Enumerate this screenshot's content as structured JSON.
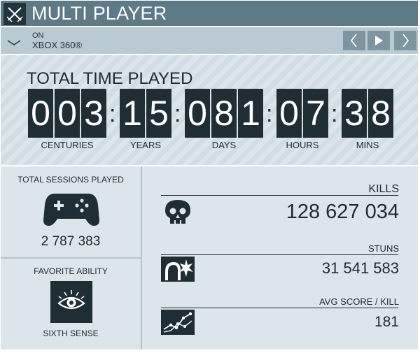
{
  "header": {
    "title": "MULTI PLAYER",
    "logo_icon": "crossed-swords-icon"
  },
  "platform": {
    "prefix": "ON",
    "name": "XBOX 360®",
    "nav": [
      "prev-chevron-icon",
      "play-icon",
      "next-chevron-icon"
    ]
  },
  "time_played": {
    "title": "TOTAL TIME PLAYED",
    "units": [
      {
        "label": "CENTURIES",
        "digits": [
          "0",
          "0",
          "3"
        ]
      },
      {
        "label": "YEARS",
        "digits": [
          "1",
          "5"
        ]
      },
      {
        "label": "DAYS",
        "digits": [
          "0",
          "8",
          "1"
        ]
      },
      {
        "label": "HOURS",
        "digits": [
          "0",
          "7"
        ]
      },
      {
        "label": "MINS",
        "digits": [
          "3",
          "8"
        ]
      }
    ],
    "separator": ":"
  },
  "sessions": {
    "label": "TOTAL SESSIONS PLAYED",
    "value": "2 787 383",
    "icon": "gamepad-icon"
  },
  "favorite_ability": {
    "label": "FAVORITE ABILITY",
    "value": "SIXTH SENSE",
    "icon": "eye-icon"
  },
  "stats": {
    "kills": {
      "label": "KILLS",
      "value": "128 627 034",
      "icon": "skull-icon"
    },
    "stuns": {
      "label": "STUNS",
      "value": "31 541 583",
      "icon": "stun-icon"
    },
    "avg_score": {
      "label": "AVG SCORE / KILL",
      "value": "181",
      "icon": "score-graph-icon"
    }
  },
  "colors": {
    "header_bg": "#5d7a86",
    "platform_bg": "#b9cad2",
    "panel_bg": "#dce6ea",
    "tile_dark": "#1f2e35"
  }
}
